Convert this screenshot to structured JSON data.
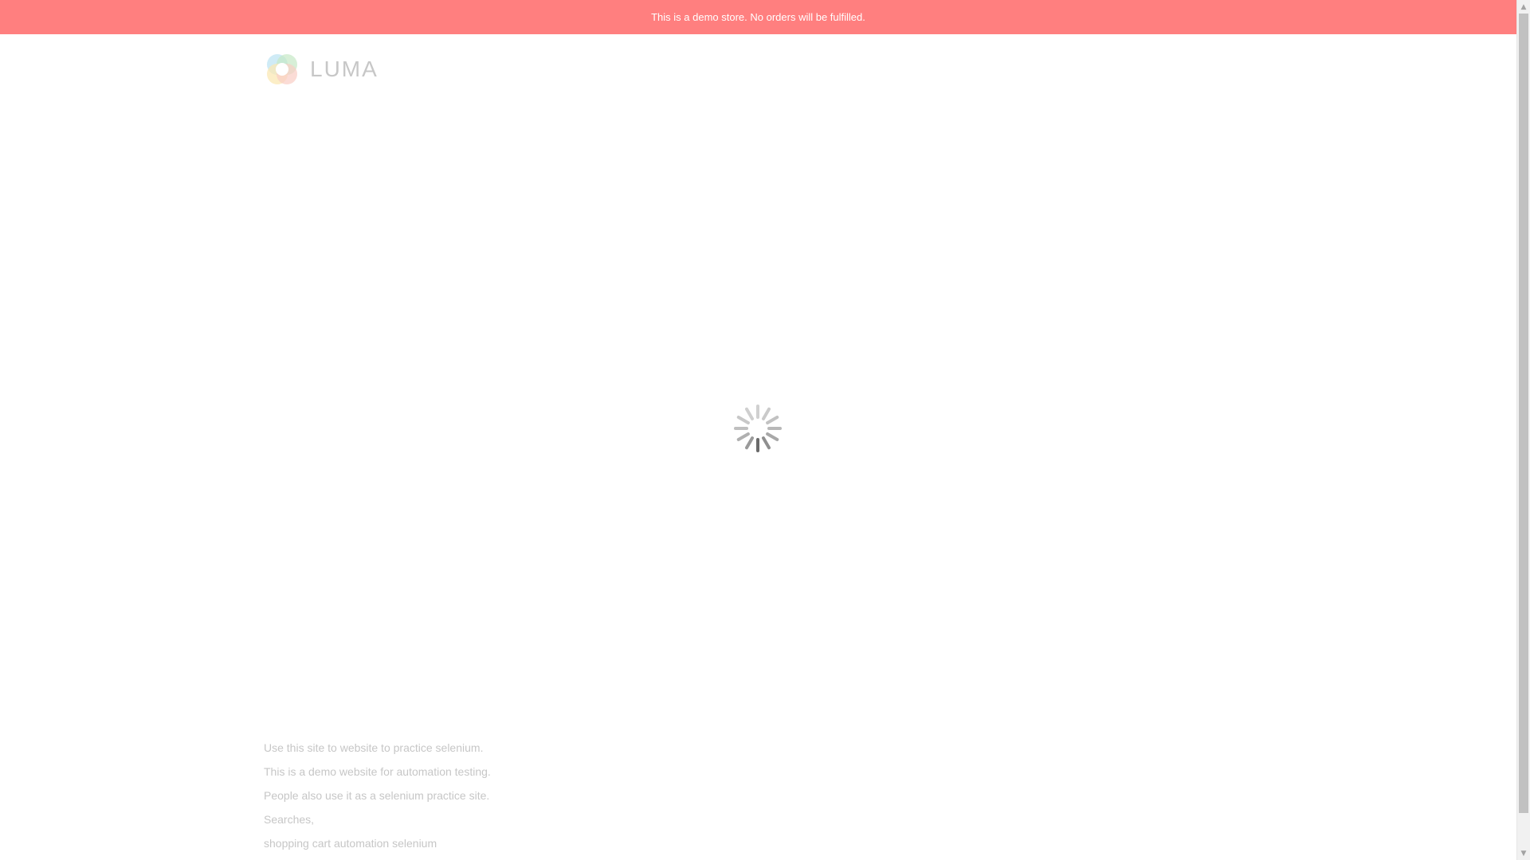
{
  "notice": {
    "text": "This is a demo store. No orders will be fulfilled."
  },
  "header": {
    "logo_text": "LUMA"
  },
  "loader": {
    "icon": "loading-spinner-icon"
  },
  "footer": {
    "lines": [
      "Use this site to website to practice selenium.",
      "This is a demo website for automation testing.",
      "People also use it as a selenium practice site.",
      "Searches,",
      "shopping cart automation selenium"
    ]
  },
  "scrollbar": {
    "up_icon": "scroll-up-arrow-icon",
    "down_icon": "scroll-down-arrow-icon"
  },
  "colors": {
    "notice_bg": "#ff7f7f",
    "notice_text": "#ffffff",
    "body_text": "#8c8c8c",
    "logo_text": "#7b7b7b"
  }
}
